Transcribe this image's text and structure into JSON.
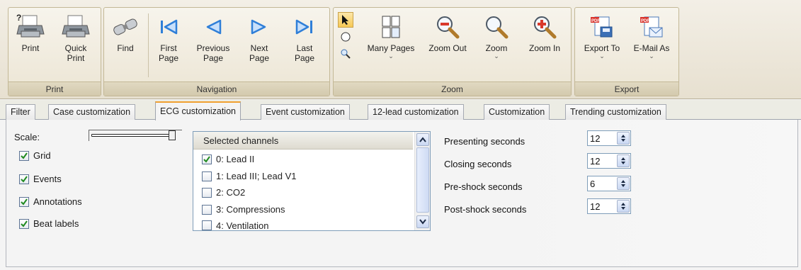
{
  "ribbon": {
    "groups": {
      "print": "Print",
      "navigation": "Navigation",
      "zoom": "Zoom",
      "export": "Export"
    },
    "buttons": {
      "print": "Print",
      "quick_print": "Quick\nPrint",
      "find": "Find",
      "first_page": "First\nPage",
      "previous_page": "Previous\nPage",
      "next_page": "Next\nPage",
      "last_page": "Last\nPage",
      "many_pages": "Many Pages",
      "zoom_out": "Zoom Out",
      "zoom": "Zoom",
      "zoom_in": "Zoom In",
      "export_to": "Export To",
      "email_as": "E-Mail As"
    },
    "dropdown_glyph": "⌄"
  },
  "tabs": [
    {
      "label": "Filter"
    },
    {
      "label": "Case customization"
    },
    {
      "label": "ECG customization"
    },
    {
      "label": "Event customization"
    },
    {
      "label": "12-lead customization"
    },
    {
      "label": "Customization"
    },
    {
      "label": "Trending customization"
    }
  ],
  "ecg": {
    "scale_label": "Scale:",
    "options": [
      {
        "label": "Grid",
        "checked": true
      },
      {
        "label": "Events",
        "checked": true
      },
      {
        "label": "Annotations",
        "checked": true
      },
      {
        "label": "Beat labels",
        "checked": true
      }
    ],
    "channels": {
      "header": "Selected channels",
      "items": [
        {
          "label": "0: Lead II",
          "checked": true
        },
        {
          "label": "1: Lead III; Lead V1",
          "checked": false
        },
        {
          "label": "2: CO2",
          "checked": false
        },
        {
          "label": "3: Compressions",
          "checked": false
        },
        {
          "label": "4: Ventilation",
          "checked": false
        }
      ]
    },
    "seconds": [
      {
        "label": "Presenting seconds",
        "value": "12"
      },
      {
        "label": "Closing seconds",
        "value": "12"
      },
      {
        "label": "Pre-shock seconds",
        "value": "6"
      },
      {
        "label": "Post-shock seconds",
        "value": "12"
      }
    ]
  },
  "colors": {
    "active_tab_accent": "#f0a030",
    "nav_arrow": "#2f7fd8",
    "ribbon_bg": "#ece5d4"
  }
}
